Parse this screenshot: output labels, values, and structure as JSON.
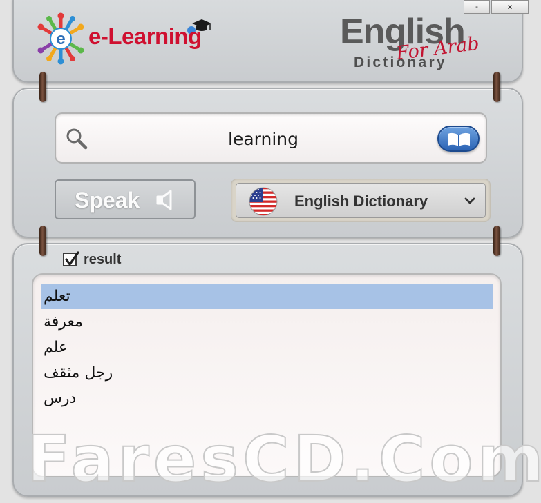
{
  "window": {
    "minimize_label": "-",
    "close_label": "x"
  },
  "branding": {
    "logo_text": "e-Learning",
    "logo_letter": "e",
    "logo_colors": [
      "#e23a3a",
      "#f2a81d",
      "#2d8fd5",
      "#5bb84a",
      "#8a3fa8"
    ],
    "product_title": "English",
    "product_accent": "For Arab",
    "product_subtitle": "Dictionary"
  },
  "search": {
    "icon": "search-icon",
    "value": "learning",
    "button_icon": "book-icon"
  },
  "speak": {
    "label": "Speak",
    "icon": "speaker-icon"
  },
  "language_select": {
    "selected": "English Dictionary",
    "flag_icon": "us-flag-icon",
    "icon": "chevron-down-icon"
  },
  "result": {
    "checkbox_checked": true,
    "label": "result",
    "items": [
      "تعلم",
      "معرفة",
      "علم",
      "رجل مثقف",
      "درس"
    ],
    "selected_index": 0
  },
  "watermark": "FaresCD.Com",
  "colors": {
    "accent": "#2b63b4",
    "brand_red": "#cf1030",
    "selection": "#a7c2e6"
  }
}
